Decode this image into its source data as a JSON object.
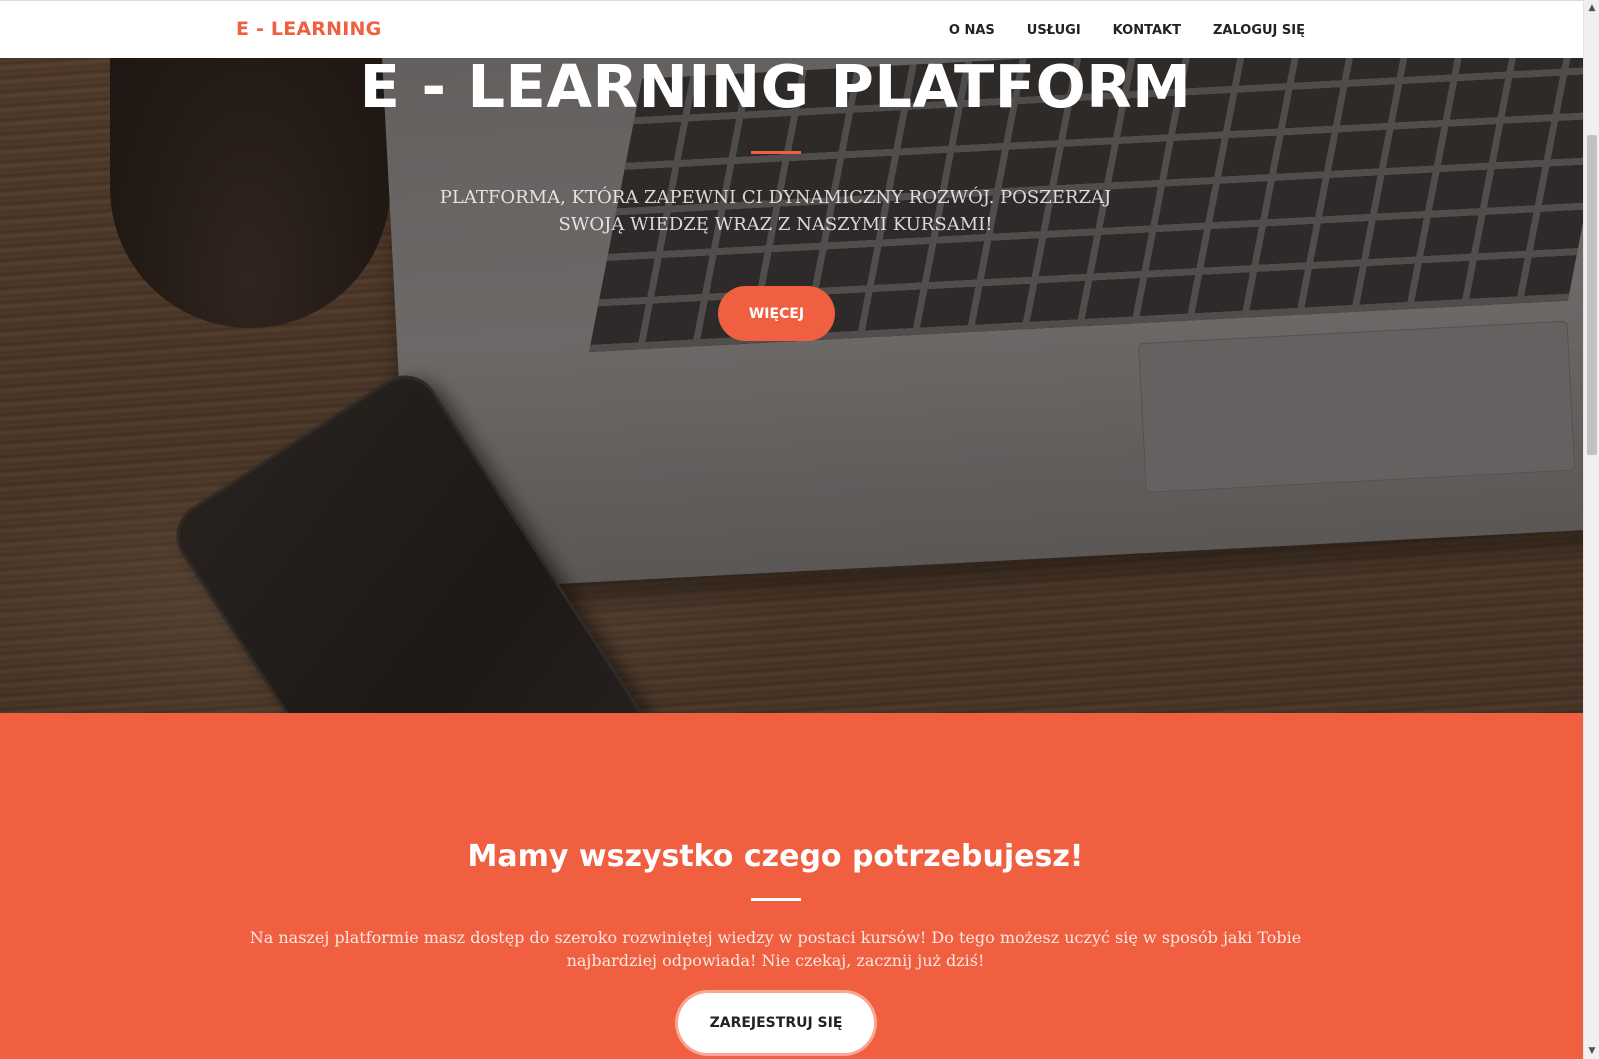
{
  "navbar": {
    "brand": "E - LEARNING",
    "links": [
      {
        "label": "O NAS"
      },
      {
        "label": "USŁUGI"
      },
      {
        "label": "KONTAKT"
      },
      {
        "label": "ZALOGUJ SIĘ"
      }
    ]
  },
  "hero": {
    "title": "E - LEARNING PLATFORM",
    "subtitle": "PLATFORMA, KTÓRA ZAPEWNI CI DYNAMICZNY ROZWÓJ. POSZERZAJ SWOJĄ WIEDZĘ WRAZ Z NASZYMI KURSAMI!",
    "button_label": "WIĘCEJ"
  },
  "services": {
    "title": "Mamy wszystko czego potrzebujesz!",
    "text": "Na naszej platformie masz dostęp do szeroko rozwiniętej wiedzy w postaci kursów! Do tego możesz uczyć się w sposób jaki Tobie najbardziej odpowiada! Nie czekaj, zacznij już dziś!",
    "button_label": "ZAREJESTRUJ SIĘ"
  },
  "scrollbar": {
    "up_icon": "▲",
    "down_icon": "▼"
  },
  "colors": {
    "accent": "#f05f40",
    "nav_text": "#222222",
    "white": "#ffffff"
  }
}
